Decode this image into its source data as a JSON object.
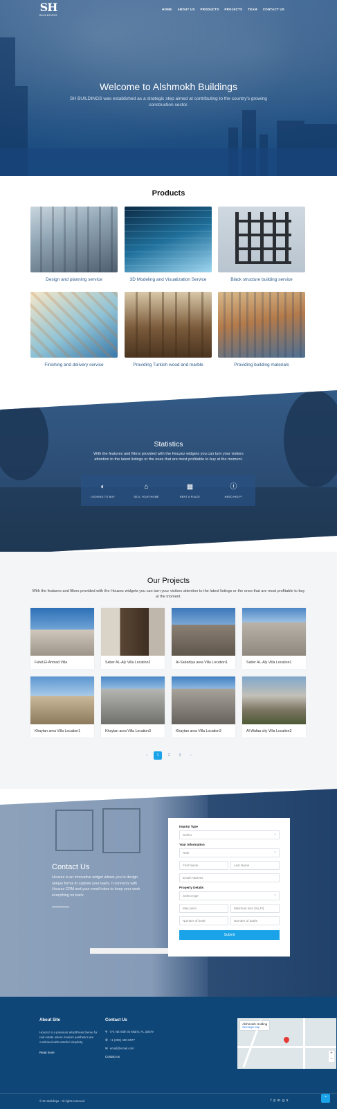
{
  "brand": {
    "logo_mark": "SH",
    "logo_sub": "BUILDINGS"
  },
  "nav": {
    "items": [
      "HOME",
      "ABOUT US",
      "PRODUCTS",
      "PROJECTS",
      "TEAM",
      "CONTACT US"
    ]
  },
  "hero": {
    "title": "Welcome to Alshmokh Buildings",
    "subtitle": "SH BUILDINGS was established as a strategic step aimed at contributing to the country's growing construction sector."
  },
  "products": {
    "title": "Products",
    "items": [
      "Design and planning service",
      "3D Modeling and Visualization Service",
      "Black structure building service",
      "Finishing and delivery service",
      "Providing Turkish wood and marble",
      "Providing building materials"
    ]
  },
  "stats": {
    "title": "Statistics",
    "description": "With the features and filters provided with the Houzez widgets you can turn your visitors attention to the latest listings or the ones that are most profitable to buy at the moment.",
    "items": [
      {
        "label": "LOOKING TO BUY",
        "icon": "buy-icon"
      },
      {
        "label": "SELL YOUR HOME",
        "icon": "sell-home-icon"
      },
      {
        "label": "RENT A PLACE",
        "icon": "rent-icon"
      },
      {
        "label": "NEED HELP?",
        "icon": "help-icon"
      }
    ]
  },
  "projects": {
    "title": "Our Projects",
    "description": "With the features and filters provided with the Houzez widgets you can turn your visitors attention to the latest listings or the ones that are most profitable to buy at the moment.",
    "items": [
      "Fahd El-Ahmad Villa",
      "Saber AL-Aly Villa Location2",
      "Al-Sabahiya area Villa Location1",
      "Saber AL-Aly Villa Location1",
      "Khaytan area Villa Location1",
      "Khaytan area Villa Location3",
      "Khaytan area Villa Location2",
      "Al-Wafaa city Villa Location2"
    ],
    "pager": [
      "‹",
      "1",
      "2",
      "3",
      "›"
    ]
  },
  "contact": {
    "title": "Contact Us",
    "description": "Houzez is an innovative widget allows you to design unique forms to capture your leads. It connects with Houzez CRM and your email inbox to keep your work everything on track.",
    "form": {
      "inquiry_label": "Inquiry Type",
      "inquiry_placeholder": "Select",
      "info_label": "Your Information",
      "role_placeholder": "Role",
      "first_name": "First Name",
      "last_name": "Last Name",
      "email": "Email Address",
      "property_label": "Property Details",
      "type_placeholder": "Select type",
      "max_price": "Max price",
      "min_size": "Minimum size (Sq Ft)",
      "beds": "Number of beds",
      "baths": "Number of baths",
      "submit": "Submit"
    }
  },
  "footer": {
    "about_title": "About Site",
    "about_text": "Houzez is a premium WordPress theme for real estate where modern aesthetics are combined with tasteful simplicity.",
    "read_more": "Read more",
    "contact_title": "Contact Us",
    "address": "774 NE 84th St Miami, FL 33879",
    "phone": "+1 (305) 490-0577",
    "email": "email@email.com",
    "contact_link": "Contact us",
    "map_place": "Alshmokh Holding",
    "map_link": "View larger map",
    "copyright": "© SH Buildings - All rights reserved",
    "social": [
      "f",
      "p",
      "in",
      "g",
      "x"
    ]
  },
  "colors": {
    "primary_blue": "#0e4677",
    "accent": "#1aa3e8",
    "caption_blue": "#2c5a8a"
  }
}
